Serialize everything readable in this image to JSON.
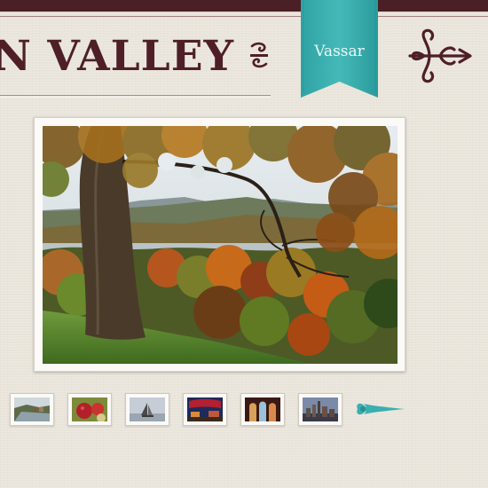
{
  "header": {
    "title": "N VALLEY",
    "ribbon_label": "Vassar",
    "colors": {
      "maroon": "#4e1f27",
      "teal": "#3fb4b4",
      "background": "#ebe6dc"
    }
  },
  "icons": {
    "title_ornament": "scroll-ornament-icon",
    "logo": "fleur-de-lis-icon",
    "next": "right-arrow-icon"
  },
  "gallery": {
    "main_photo": "autumn-tree-river-valley",
    "thumbnails": [
      {
        "name": "river-town"
      },
      {
        "name": "apples"
      },
      {
        "name": "sailboat"
      },
      {
        "name": "stage"
      },
      {
        "name": "arched-windows"
      },
      {
        "name": "city-skyline"
      }
    ]
  }
}
